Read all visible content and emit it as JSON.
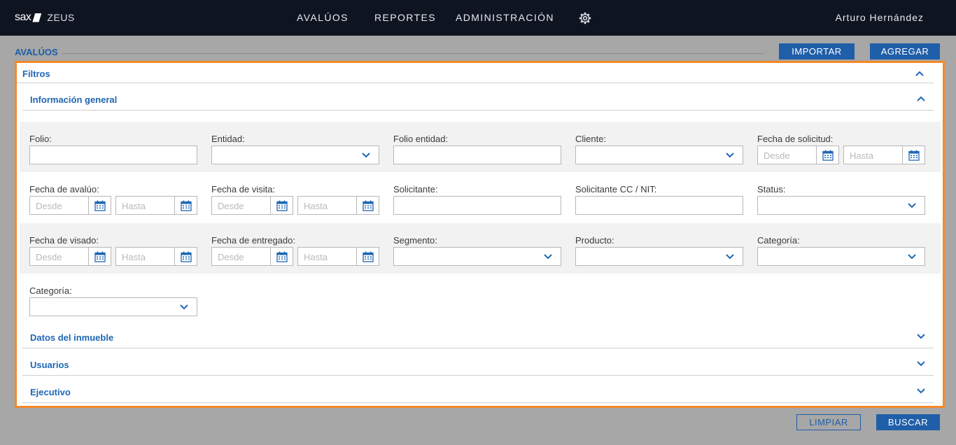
{
  "brand": {
    "logo": "sax",
    "product": "ZEUS"
  },
  "nav": {
    "items": [
      {
        "label": "AVALÚOS"
      },
      {
        "label": "REPORTES"
      },
      {
        "label": "ADMINISTRACIÓN"
      }
    ],
    "settings_icon": "gear-icon",
    "user_name": "Arturo Hernández"
  },
  "page": {
    "title": "AVALÚOS",
    "import_label": "IMPORTAR",
    "add_label": "AGREGAR"
  },
  "filters": {
    "title": "Filtros",
    "general": {
      "title": "Información general",
      "fields": {
        "folio": "Folio:",
        "entidad": "Entidad:",
        "folio_entidad": "Folio entidad:",
        "cliente": "Cliente:",
        "fecha_solicitud": "Fecha de solicitud:",
        "fecha_avaluo": "Fecha de avalúo:",
        "fecha_visita": "Fecha de visita:",
        "solicitante": "Solicitante:",
        "solicitante_nit": "Solicitante CC / NIT:",
        "status": "Status:",
        "fecha_visado": "Fecha de visado:",
        "fecha_entregado": "Fecha de entregado:",
        "segmento": "Segmento:",
        "producto": "Producto:",
        "categoria": "Categoría:",
        "categoria2": "Categoría:"
      },
      "placeholders": {
        "from": "Desde",
        "to": "Hasta"
      }
    },
    "collapsed_sections": [
      {
        "title": "Datos del inmueble"
      },
      {
        "title": "Usuarios"
      },
      {
        "title": "Ejecutivo"
      }
    ]
  },
  "actions": {
    "clear_label": "LIMPIAR",
    "search_label": "BUSCAR"
  },
  "colors": {
    "accent": "#1f5ea8",
    "highlight": "#f28a2a",
    "topbar": "#0f1421"
  }
}
